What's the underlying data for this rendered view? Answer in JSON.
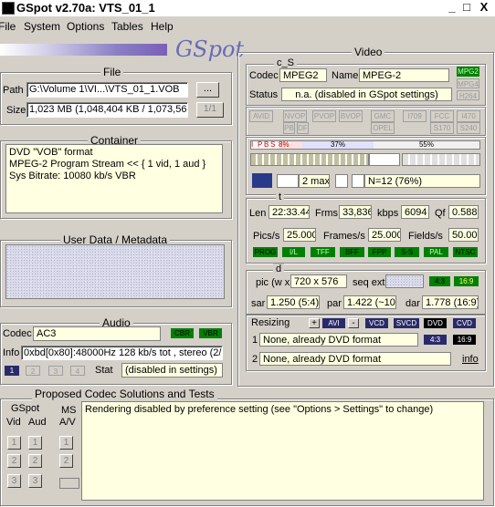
{
  "window": {
    "title": "GSpot v2.70a: VTS_01_1",
    "minimize": "_",
    "maximize": "□",
    "close": "X"
  },
  "menu": [
    "File",
    "System",
    "Options",
    "Tables",
    "Help"
  ],
  "brand": "GSpot",
  "file": {
    "legend": "File",
    "path_label": "Path",
    "path_value": "G:\\Volume 1\\VI...\\VTS_01_1.VOB",
    "browse_label": "...",
    "size_label": "Size",
    "size_value": "1,023 MB (1,048,404 KB / 1,073,56",
    "page_label": "1/1"
  },
  "container": {
    "legend": "Container",
    "lines": [
      "DVD \"VOB\" format",
      "MPEG-2 Program Stream << { 1 vid, 1 aud }",
      "Sys Bitrate: 10080 kb/s VBR"
    ]
  },
  "userdata": {
    "legend": "User Data / Metadata"
  },
  "audio": {
    "legend": "Audio",
    "codec_label": "Codec",
    "codec_value": "AC3",
    "cbr": "CBR",
    "vbr": "VBR",
    "info_label": "Info",
    "info_value": "0xbd[0x80]:48000Hz  128 kb/s tot , stereo (2/",
    "streams": [
      "1",
      "2",
      "3",
      "4"
    ],
    "stat_label": "Stat",
    "stat_value": "(disabled in settings)"
  },
  "video": {
    "legend": "Video",
    "cs_legend": "c_S",
    "codec_label": "Codec",
    "codec_value": "MPEG2",
    "name_label": "Name",
    "name_value": "MPEG-2",
    "status_label": "Status",
    "status_value": "n.a. (disabled in GSpot settings)",
    "codec_tags": [
      "MPG2",
      "MPG4",
      "H264"
    ],
    "flag_tags_row1": [
      "AVID",
      "NVOP",
      "PVOP",
      "BVOP",
      "GMC",
      "I709",
      "FCC",
      "I470"
    ],
    "flag_tags_row2": [
      "PB",
      "DF",
      "OPEL",
      "S170",
      "S240"
    ],
    "gop_letters": [
      "I",
      "P",
      "B",
      "S"
    ],
    "gop_pcts": [
      "8%",
      "37%",
      "55%"
    ],
    "bframes": "2 max",
    "gop_n": "N=12 (76%)",
    "t_legend": "t",
    "len_label": "Len",
    "len_value": "22:33.44",
    "frms_label": "Frms",
    "frms_value": "33,836",
    "kbps_label": "kbps",
    "kbps_value": "6094",
    "qf_label": "Qf",
    "qf_value": "0.588",
    "pics_label": "Pics/s",
    "pics_value": "25.000",
    "frames_label": "Frames/s",
    "frames_value": "25.000",
    "fields_label": "Fields/s",
    "fields_value": "50.00",
    "scan_tags": [
      "PROG",
      "I/L",
      "TFF",
      "BFF",
      "FPP",
      "S-S",
      "PAL",
      "NTSC"
    ],
    "d_legend": "d",
    "pic_label": "pic (w x",
    "pic_value": "720 x 576",
    "seqext_label": "seq ext",
    "ar_tags": [
      "4:3",
      "16:9"
    ],
    "sar_label": "sar",
    "sar_value": "1.250 (5:4)",
    "par_label": "par",
    "par_value": "1.422 (~10:",
    "dar_label": "dar",
    "dar_value": "1.778 (16:9)",
    "resizing_label": "Resizing",
    "resize_btns": [
      "+",
      "AVI",
      "-",
      "VCD",
      "SVCD",
      "DVD",
      "CVD"
    ],
    "resize1_num": "1",
    "resize1_value": "None, already DVD format",
    "resize1_tags": [
      "4:3",
      "16:9"
    ],
    "resize2_num": "2",
    "resize2_value": "None, already DVD format",
    "info_link": "info"
  },
  "proposed": {
    "legend": "Proposed Codec Solutions and Tests",
    "gspot_label": "GSpot",
    "vid_label": "Vid",
    "aud_label": "Aud",
    "ms_label": "MS",
    "av_label": "A/V",
    "message": "Rendering disabled by preference setting (see \"Options > Settings\" to change)"
  },
  "colors": {
    "background": "#d4d0c8",
    "highlight_green": "#008000",
    "panel_yellow": "#ffffe1"
  }
}
